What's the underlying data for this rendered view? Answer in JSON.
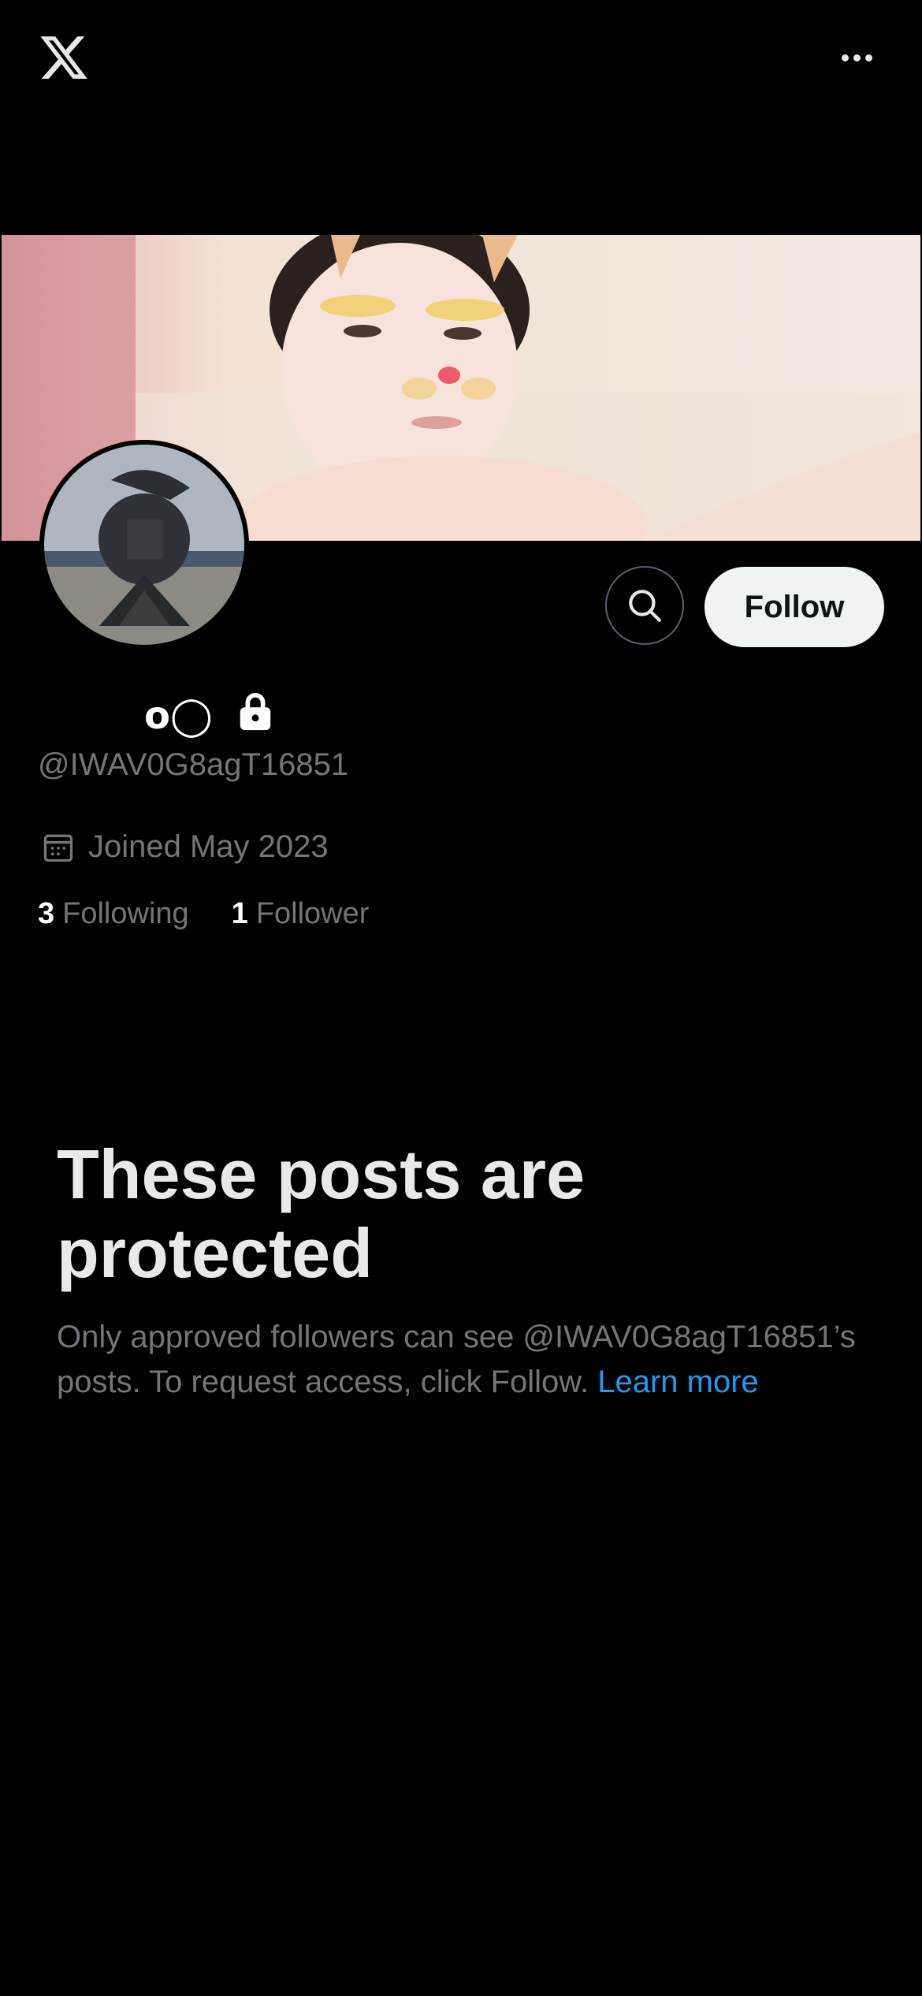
{
  "header": {
    "logo_icon": "x-logo-icon",
    "more_icon": "more-horizontal-icon"
  },
  "profile": {
    "banner_alt": "profile banner image",
    "avatar_alt": "profile avatar image",
    "display_name": "o◯",
    "protected_icon": "lock-icon",
    "handle": "@IWAV0G8agT16851",
    "joined_icon": "calendar-icon",
    "joined": "Joined May 2023",
    "following_count": "3",
    "following_label": "Following",
    "followers_count": "1",
    "followers_label": "Follower"
  },
  "actions": {
    "search_icon": "search-icon",
    "follow_label": "Follow"
  },
  "protected": {
    "title": "These posts are protected",
    "body": "Only approved followers can see @IWAV0G8agT16851’s posts. To request access, click Follow.",
    "learn_more": "Learn more"
  },
  "colors": {
    "background": "#000000",
    "text_primary": "#e7e9ea",
    "text_secondary": "#71767b",
    "link": "#1d9bf0",
    "follow_button_bg": "#eff3f4"
  }
}
